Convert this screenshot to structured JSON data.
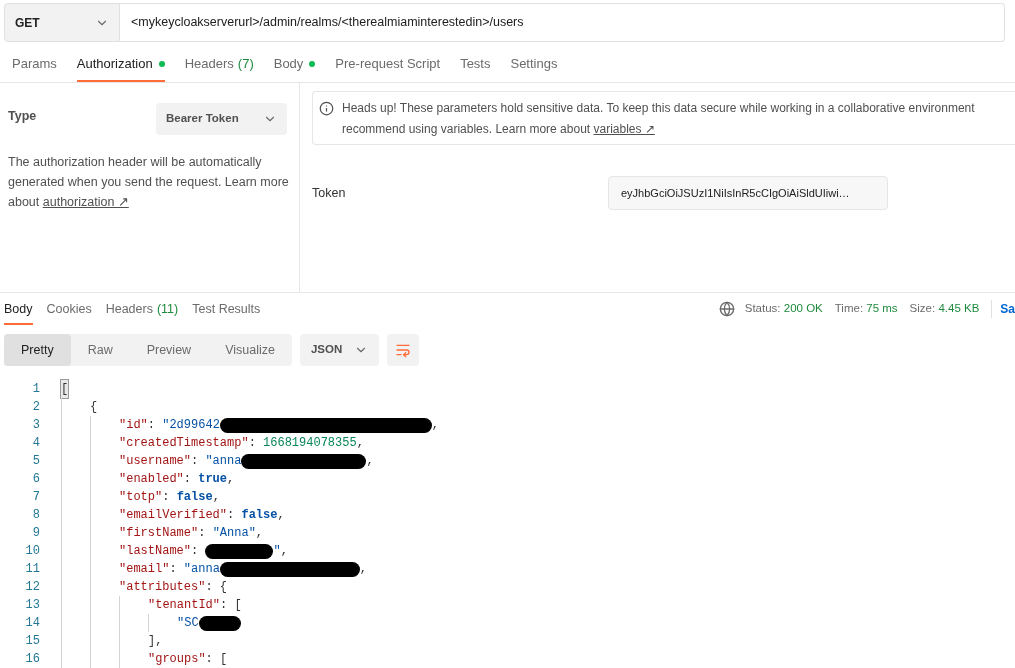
{
  "request": {
    "method": "GET",
    "url": "<mykeycloakserverurl>/admin/realms/<therealmiaminterestedin>/users"
  },
  "request_tabs": [
    {
      "label": "Params",
      "selected": false
    },
    {
      "label": "Authorization",
      "dot": true,
      "selected": true
    },
    {
      "label": "Headers",
      "count": "(7)",
      "selected": false
    },
    {
      "label": "Body",
      "dot": true,
      "selected": false
    },
    {
      "label": "Pre-request Script",
      "selected": false
    },
    {
      "label": "Tests",
      "selected": false
    },
    {
      "label": "Settings",
      "selected": false
    }
  ],
  "auth": {
    "type_label": "Type",
    "type_value": "Bearer Token",
    "description": "The authorization header will be automatically generated when you send the request. Learn more about",
    "description_link": "authorization ↗",
    "notice_line_1": "Heads up! These parameters hold sensitive data. To keep this data secure while working in a collaborative environment",
    "notice_line_2": "recommend using variables. Learn more about",
    "notice_link": "variables ↗",
    "token_label": "Token",
    "token_value": "eyJhbGciOiJSUzI1NiIsInR5cCIgOiAiSldUIiwi…"
  },
  "response_tabs": [
    {
      "label": "Body",
      "selected": true
    },
    {
      "label": "Cookies",
      "selected": false
    },
    {
      "label": "Headers",
      "count": "(11)",
      "selected": false
    },
    {
      "label": "Test Results",
      "selected": false
    }
  ],
  "response_meta": [
    {
      "label": "Status:",
      "value": "200 OK"
    },
    {
      "label": "Time:",
      "value": "75 ms"
    },
    {
      "label": "Size:",
      "value": "4.45 KB"
    }
  ],
  "save_link": "Sa",
  "view_modes": [
    {
      "label": "Pretty",
      "selected": true
    },
    {
      "label": "Raw",
      "selected": false
    },
    {
      "label": "Preview",
      "selected": false
    },
    {
      "label": "Visualize",
      "selected": false
    }
  ],
  "format": "JSON",
  "code_lines": [
    {
      "number": "1",
      "tokens": [
        {
          "kind": "bracket",
          "text": "["
        }
      ],
      "children": [
        {
          "number": "2",
          "tokens": [
            {
              "kind": "punct",
              "text": "{"
            }
          ],
          "children": [
            {
              "number": "3",
              "tokens": [
                {
                  "kind": "key",
                  "text": "\"id\""
                },
                {
                  "kind": "punct",
                  "text": ": "
                },
                {
                  "kind": "string",
                  "text": "\"2d99642"
                },
                {
                  "kind": "redaction"
                },
                {
                  "kind": "punct",
                  "text": ","
                }
              ]
            },
            {
              "number": "4",
              "tokens": [
                {
                  "kind": "key",
                  "text": "\"createdTimestamp\""
                },
                {
                  "kind": "punct",
                  "text": ": "
                },
                {
                  "kind": "number",
                  "text": "1668194078355"
                },
                {
                  "kind": "punct",
                  "text": ","
                }
              ]
            },
            {
              "number": "5",
              "tokens": [
                {
                  "kind": "key",
                  "text": "\"username\""
                },
                {
                  "kind": "punct",
                  "text": ": "
                },
                {
                  "kind": "string",
                  "text": "\"anna"
                },
                {
                  "kind": "redaction"
                },
                {
                  "kind": "punct",
                  "text": ","
                }
              ]
            },
            {
              "number": "6",
              "tokens": [
                {
                  "kind": "key",
                  "text": "\"enabled\""
                },
                {
                  "kind": "punct",
                  "text": ": "
                },
                {
                  "kind": "bool",
                  "text": "true"
                },
                {
                  "kind": "punct",
                  "text": ","
                }
              ]
            },
            {
              "number": "7",
              "tokens": [
                {
                  "kind": "key",
                  "text": "\"totp\""
                },
                {
                  "kind": "punct",
                  "text": ": "
                },
                {
                  "kind": "bool",
                  "text": "false"
                },
                {
                  "kind": "punct",
                  "text": ","
                }
              ]
            },
            {
              "number": "8",
              "tokens": [
                {
                  "kind": "key",
                  "text": "\"emailVerified\""
                },
                {
                  "kind": "punct",
                  "text": ": "
                },
                {
                  "kind": "bool",
                  "text": "false"
                },
                {
                  "kind": "punct",
                  "text": ","
                }
              ]
            },
            {
              "number": "9",
              "tokens": [
                {
                  "kind": "key",
                  "text": "\"firstName\""
                },
                {
                  "kind": "punct",
                  "text": ": "
                },
                {
                  "kind": "string",
                  "text": "\"Anna\""
                },
                {
                  "kind": "punct",
                  "text": ","
                }
              ]
            },
            {
              "number": "10",
              "tokens": [
                {
                  "kind": "key",
                  "text": "\"lastName\""
                },
                {
                  "kind": "punct",
                  "text": ": "
                },
                {
                  "kind": "redaction"
                },
                {
                  "kind": "string",
                  "text": "\""
                },
                {
                  "kind": "punct",
                  "text": ","
                }
              ]
            },
            {
              "number": "11",
              "tokens": [
                {
                  "kind": "key",
                  "text": "\"email\""
                },
                {
                  "kind": "punct",
                  "text": ": "
                },
                {
                  "kind": "string",
                  "text": "\"anna"
                },
                {
                  "kind": "redaction"
                },
                {
                  "kind": "punct",
                  "text": ","
                }
              ]
            },
            {
              "number": "12",
              "tokens": [
                {
                  "kind": "key",
                  "text": "\"attributes\""
                },
                {
                  "kind": "punct",
                  "text": ": {"
                }
              ],
              "children": [
                {
                  "number": "13",
                  "tokens": [
                    {
                      "kind": "key",
                      "text": "\"tenantId\""
                    },
                    {
                      "kind": "punct",
                      "text": ": ["
                    }
                  ],
                  "children": [
                    {
                      "number": "14",
                      "tokens": [
                        {
                          "kind": "string",
                          "text": "\"SC"
                        },
                        {
                          "kind": "redaction"
                        }
                      ]
                    }
                  ]
                },
                {
                  "number": "15",
                  "tokens": [
                    {
                      "kind": "punct",
                      "text": "],"
                    }
                  ]
                },
                {
                  "number": "16",
                  "tokens": [
                    {
                      "kind": "key",
                      "text": "\"groups\""
                    },
                    {
                      "kind": "punct",
                      "text": ": ["
                    }
                  ]
                }
              ]
            }
          ]
        }
      ]
    }
  ]
}
